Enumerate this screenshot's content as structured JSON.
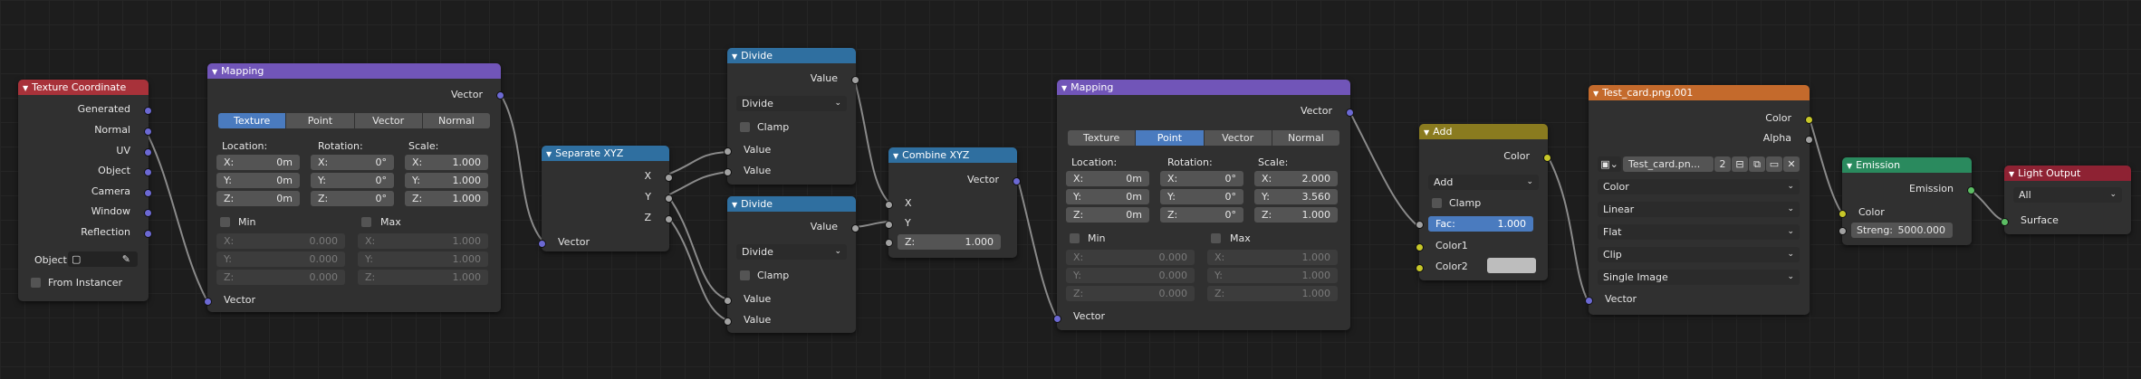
{
  "nodes": {
    "texcoord": {
      "title": "Texture Coordinate",
      "outputs": [
        "Generated",
        "Normal",
        "UV",
        "Object",
        "Camera",
        "Window",
        "Reflection"
      ],
      "object_label": "Object",
      "from_instancer": "From Instancer",
      "vector_out": "Vector"
    },
    "mapping1": {
      "title": "Mapping",
      "out": "Vector",
      "tabs": [
        "Texture",
        "Point",
        "Vector",
        "Normal"
      ],
      "active_tab": "Texture",
      "loc_label": "Location:",
      "rot_label": "Rotation:",
      "scale_label": "Scale:",
      "loc": [
        [
          "X:",
          "0m"
        ],
        [
          "Y:",
          "0m"
        ],
        [
          "Z:",
          "0m"
        ]
      ],
      "rot": [
        [
          "X:",
          "0°"
        ],
        [
          "Y:",
          "0°"
        ],
        [
          "Z:",
          "0°"
        ]
      ],
      "scale": [
        [
          "X:",
          "1.000"
        ],
        [
          "Y:",
          "1.000"
        ],
        [
          "Z:",
          "1.000"
        ]
      ],
      "min_label": "Min",
      "max_label": "Max",
      "min": [
        [
          "X:",
          "0.000"
        ],
        [
          "Y:",
          "0.000"
        ],
        [
          "Z:",
          "0.000"
        ]
      ],
      "max": [
        [
          "X:",
          "1.000"
        ],
        [
          "Y:",
          "1.000"
        ],
        [
          "Z:",
          "1.000"
        ]
      ],
      "in": "Vector"
    },
    "sepxyz": {
      "title": "Separate XYZ",
      "outs": [
        "X",
        "Y",
        "Z"
      ],
      "in": "Vector"
    },
    "divide1": {
      "title": "Divide",
      "out": "Value",
      "op": "Divide",
      "clamp": "Clamp",
      "in1": "Value",
      "in2": "Value"
    },
    "divide2": {
      "title": "Divide",
      "out": "Value",
      "op": "Divide",
      "clamp": "Clamp",
      "in1": "Value",
      "in2": "Value"
    },
    "combxyz": {
      "title": "Combine XYZ",
      "out": "Vector",
      "x": "X",
      "y": "Y",
      "z_label": "Z:",
      "z_val": "1.000"
    },
    "mapping2": {
      "title": "Mapping",
      "out": "Vector",
      "tabs": [
        "Texture",
        "Point",
        "Vector",
        "Normal"
      ],
      "active_tab": "Point",
      "loc_label": "Location:",
      "rot_label": "Rotation:",
      "scale_label": "Scale:",
      "loc": [
        [
          "X:",
          "0m"
        ],
        [
          "Y:",
          "0m"
        ],
        [
          "Z:",
          "0m"
        ]
      ],
      "rot": [
        [
          "X:",
          "0°"
        ],
        [
          "Y:",
          "0°"
        ],
        [
          "Z:",
          "0°"
        ]
      ],
      "scale": [
        [
          "X:",
          "2.000"
        ],
        [
          "Y:",
          "3.560"
        ],
        [
          "Z:",
          "1.000"
        ]
      ],
      "min_label": "Min",
      "max_label": "Max",
      "min": [
        [
          "X:",
          "0.000"
        ],
        [
          "Y:",
          "0.000"
        ],
        [
          "Z:",
          "0.000"
        ]
      ],
      "max": [
        [
          "X:",
          "1.000"
        ],
        [
          "Y:",
          "1.000"
        ],
        [
          "Z:",
          "1.000"
        ]
      ],
      "in": "Vector"
    },
    "add": {
      "title": "Add",
      "out": "Color",
      "op": "Add",
      "clamp": "Clamp",
      "fac_label": "Fac:",
      "fac_val": "1.000",
      "color1": "Color1",
      "color2": "Color2"
    },
    "image": {
      "title": "Test_card.png.001",
      "out_color": "Color",
      "out_alpha": "Alpha",
      "image_name": "Test_card.pn...",
      "users": "2",
      "color": "Color",
      "interp": "Linear",
      "proj": "Flat",
      "ext": "Clip",
      "source": "Single Image",
      "in": "Vector"
    },
    "emission": {
      "title": "Emission",
      "out": "Emission",
      "color": "Color",
      "strength_label": "Streng:",
      "strength_val": "5000.000"
    },
    "output": {
      "title": "Light Output",
      "target": "All",
      "surface": "Surface"
    }
  },
  "colors": {
    "vector": "#6c69d3",
    "value": "#a1a1a1",
    "color": "#c7c729",
    "shader": "#5cbd64"
  }
}
